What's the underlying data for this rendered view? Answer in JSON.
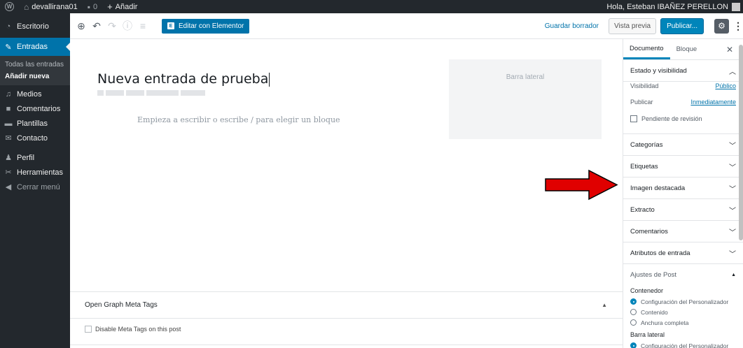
{
  "adminbar": {
    "site_name": "devallirana01",
    "comments_count": "0",
    "add_new": "Añadir",
    "greeting": "Hola, Esteban IBAÑEZ PERELLON"
  },
  "menu": {
    "dashboard": "Escritorio",
    "posts": "Entradas",
    "all_posts": "Todas las entradas",
    "add_new": "Añadir nueva",
    "media": "Medios",
    "comments": "Comentarios",
    "templates": "Plantillas",
    "contact": "Contacto",
    "profile": "Perfil",
    "tools": "Herramientas",
    "collapse": "Cerrar menú"
  },
  "toolbar": {
    "elementor": "Editar con Elementor",
    "save_draft": "Guardar borrador",
    "preview": "Vista previa",
    "publish": "Publicar..."
  },
  "editor": {
    "title": "Nueva entrada de prueba",
    "placeholder": "Empieza a escribir o escribe / para elegir un bloque",
    "sidebar_widget": "Barra lateral"
  },
  "metabox": {
    "title": "Open Graph Meta Tags",
    "disable_label": "Disable Meta Tags on this post"
  },
  "sidebar": {
    "tab_document": "Documento",
    "tab_block": "Bloque",
    "status_title": "Estado y visibilidad",
    "visibility_label": "Visibilidad",
    "visibility_value": "Público",
    "publish_label": "Publicar",
    "publish_value": "Inmediatamente",
    "pending_review": "Pendiente de revisión",
    "panels": [
      "Categorías",
      "Etiquetas",
      "Imagen destacada",
      "Extracto",
      "Comentarios",
      "Atributos de entrada"
    ],
    "ajustes_title": "Ajustes de Post",
    "container_label": "Contenedor",
    "container_options": [
      "Configuración del Personalizador",
      "Contenido",
      "Anchura completa"
    ],
    "sidebar_label": "Barra lateral",
    "sidebar_option": "Configuración del Personalizador"
  },
  "colors": {
    "admin_dark": "#23282d",
    "accent": "#0073aa",
    "annotation_arrow": "#e00000"
  }
}
